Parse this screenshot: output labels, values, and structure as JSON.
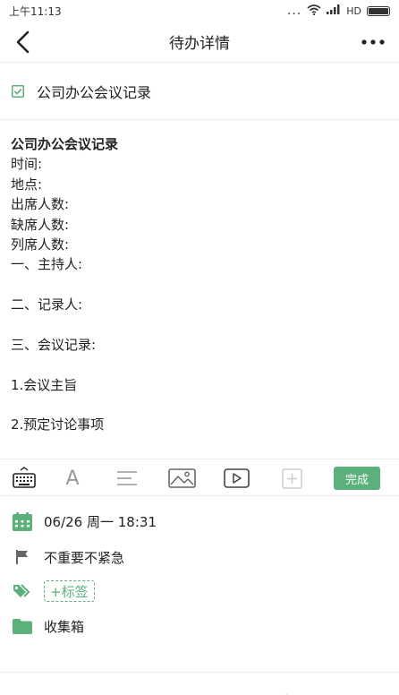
{
  "status_bar": {
    "time": "上午11:13",
    "dots": "...",
    "network": "HD"
  },
  "header": {
    "title": "待办详情"
  },
  "todo": {
    "title": "公司办公会议记录",
    "checked": true
  },
  "note": {
    "lines": [
      {
        "text": "公司办公会议记录",
        "bold": true
      },
      {
        "text": "时间:",
        "bold": false
      },
      {
        "text": "地点:",
        "bold": false
      },
      {
        "text": "出席人数:",
        "bold": false
      },
      {
        "text": "缺席人数:",
        "bold": false
      },
      {
        "text": "列席人数:",
        "bold": false
      },
      {
        "text": "一、主持人:",
        "bold": false
      },
      {
        "text": "",
        "bold": false
      },
      {
        "text": "二、记录人:",
        "bold": false
      },
      {
        "text": "",
        "bold": false
      },
      {
        "text": "三、会议记录:",
        "bold": false
      },
      {
        "text": "",
        "bold": false
      },
      {
        "text": "1.会议主旨",
        "bold": false
      },
      {
        "text": "",
        "bold": false
      },
      {
        "text": "2.预定讨论事项",
        "bold": false
      }
    ]
  },
  "toolbar": {
    "font_label": "A",
    "done_label": "完成"
  },
  "meta": {
    "date": "06/26 周一 18:31",
    "priority": "不重要不紧急",
    "tag_label": "+标签",
    "list": "收集箱"
  },
  "colors": {
    "accent": "#5bb07c",
    "icon_gray": "#888888",
    "flag_gray": "#666666"
  }
}
